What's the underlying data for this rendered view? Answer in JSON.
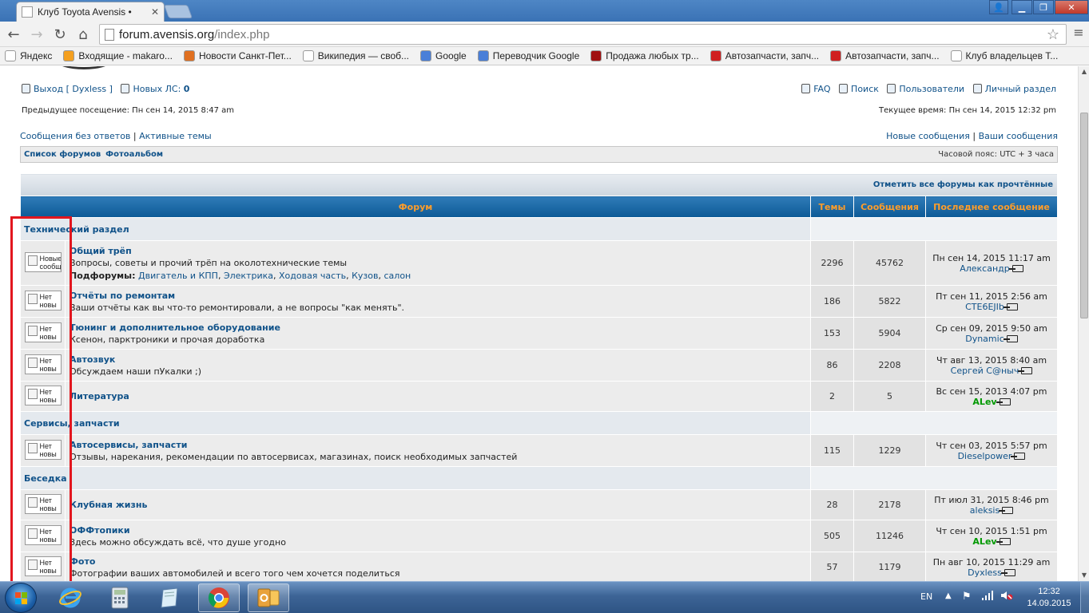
{
  "browser": {
    "tab_title": "Клуб Toyota Avensis •",
    "url_host": "forum.avensis.org",
    "url_path": "/index.php",
    "bookmarks": [
      {
        "label": "Яндекс",
        "icon": "yandex-icon",
        "color": "#ffffff"
      },
      {
        "label": "Входящие - makaro...",
        "icon": "mail-icon",
        "color": "#f4a020"
      },
      {
        "label": "Новости Санкт-Пет...",
        "icon": "news-icon",
        "color": "#e07020"
      },
      {
        "label": "Википедия — своб...",
        "icon": "wikipedia-icon",
        "color": "#ffffff"
      },
      {
        "label": "Google",
        "icon": "google-icon",
        "color": "#4a7fd8"
      },
      {
        "label": "Переводчик Google",
        "icon": "translate-icon",
        "color": "#4a7fd8"
      },
      {
        "label": "Продажа любых тр...",
        "icon": "car-icon",
        "color": "#a01010"
      },
      {
        "label": "Автозапчасти, запч...",
        "icon": "parts-icon",
        "color": "#d02020"
      },
      {
        "label": "Автозапчасти, запч...",
        "icon": "parts-icon",
        "color": "#d02020"
      },
      {
        "label": "Клуб владельцев Т...",
        "icon": "toyota-icon",
        "color": "#ffffff"
      }
    ]
  },
  "header": {
    "logout": "Выход [ Dyxless ]",
    "new_pm_label": "Новых ЛС:",
    "new_pm_count": "0",
    "faq": "FAQ",
    "search": "Поиск",
    "users": "Пользователи",
    "ucp": "Личный раздел",
    "last_visit": "Предыдущее посещение: Пн сен 14, 2015 8:47 am",
    "current_time": "Текущее время: Пн сен 14, 2015 12:32 pm",
    "unanswered": "Сообщения без ответов",
    "active": "Активные темы",
    "sep": "|",
    "new_posts": "Новые сообщения",
    "your_posts": "Ваши сообщения"
  },
  "navbar": {
    "forum_list": "Список форумов",
    "album": "Фотоальбом",
    "timezone": "Часовой пояс: UTC + 3 часа"
  },
  "table": {
    "mark_all_read": "Отметить все форумы как прочтённые",
    "col_forum": "Форум",
    "col_topics": "Темы",
    "col_posts": "Сообщения",
    "col_last": "Последнее сообщение",
    "subforums_label": "Подфорумы:"
  },
  "categories": [
    {
      "name": "Технический раздел",
      "forums": [
        {
          "icon_text": "Новые сообщ",
          "name": "Общий трёп",
          "desc": "Вопросы, советы и прочий трёп на околотехнические темы",
          "subforums": [
            "Двигатель и КПП",
            "Электрика",
            "Ходовая часть",
            "Кузов",
            "салон"
          ],
          "topics": "2296",
          "posts": "45762",
          "last_date": "Пн сен 14, 2015 11:17 am",
          "last_user": "Александр",
          "user_green": false
        },
        {
          "icon_text": "Нет новы",
          "name": "Отчёты по ремонтам",
          "desc": "Ваши отчёты как вы что-то ремонтировали, а не вопросы \"как менять\".",
          "subforums": [],
          "topics": "186",
          "posts": "5822",
          "last_date": "Пт сен 11, 2015 2:56 am",
          "last_user": "CTE6EJIb",
          "user_green": false
        },
        {
          "icon_text": "Нет новы",
          "name": "Тюнинг и дополнительное оборудование",
          "desc": "Ксенон, парктроники и прочая доработка",
          "subforums": [],
          "topics": "153",
          "posts": "5904",
          "last_date": "Ср сен 09, 2015 9:50 am",
          "last_user": "Dynamic",
          "user_green": false
        },
        {
          "icon_text": "Нет новы",
          "name": "Автозвук",
          "desc": "Обсуждаем наши пУкалки ;)",
          "subforums": [],
          "topics": "86",
          "posts": "2208",
          "last_date": "Чт авг 13, 2015 8:40 am",
          "last_user": "Сергей С@ныч",
          "user_green": false
        },
        {
          "icon_text": "Нет новы",
          "name": "Литература",
          "desc": "",
          "subforums": [],
          "topics": "2",
          "posts": "5",
          "last_date": "Вс сен 15, 2013 4:07 pm",
          "last_user": "ALev",
          "user_green": true
        }
      ]
    },
    {
      "name": "Сервисы, запчасти",
      "forums": [
        {
          "icon_text": "Нет новы",
          "name": "Автосервисы, запчасти",
          "desc": "Отзывы, нарекания, рекомендации по автосервисах, магазинах, поиск необходимых запчастей",
          "subforums": [],
          "topics": "115",
          "posts": "1229",
          "last_date": "Чт сен 03, 2015 5:57 pm",
          "last_user": "Dieselpower",
          "user_green": false
        }
      ]
    },
    {
      "name": "Беседка",
      "forums": [
        {
          "icon_text": "Нет новы",
          "name": "Клубная жизнь",
          "desc": "",
          "subforums": [],
          "topics": "28",
          "posts": "2178",
          "last_date": "Пт июл 31, 2015 8:46 pm",
          "last_user": "aleksis",
          "user_green": false
        },
        {
          "icon_text": "Нет новы",
          "name": "ОФФтопики",
          "desc": "Здесь можно обсуждать всё, что душе угодно",
          "subforums": [],
          "topics": "505",
          "posts": "11246",
          "last_date": "Чт сен 10, 2015 1:51 pm",
          "last_user": "ALev",
          "user_green": true
        },
        {
          "icon_text": "Нет новы",
          "name": "Фото",
          "desc": "Фотографии ваших автомобилей и всего того чем хочется поделиться",
          "subforums": [],
          "topics": "57",
          "posts": "1179",
          "last_date": "Пн авг 10, 2015 11:29 am",
          "last_user": "Dyxless",
          "user_green": false
        }
      ]
    }
  ],
  "taskbar": {
    "lang": "EN",
    "time": "12:32",
    "date": "14.09.2015"
  },
  "colors": {
    "link": "#105289",
    "header_gradient_top": "#2f7bb8",
    "header_text": "#ff9d2a",
    "highlight_box": "#e2161e"
  }
}
